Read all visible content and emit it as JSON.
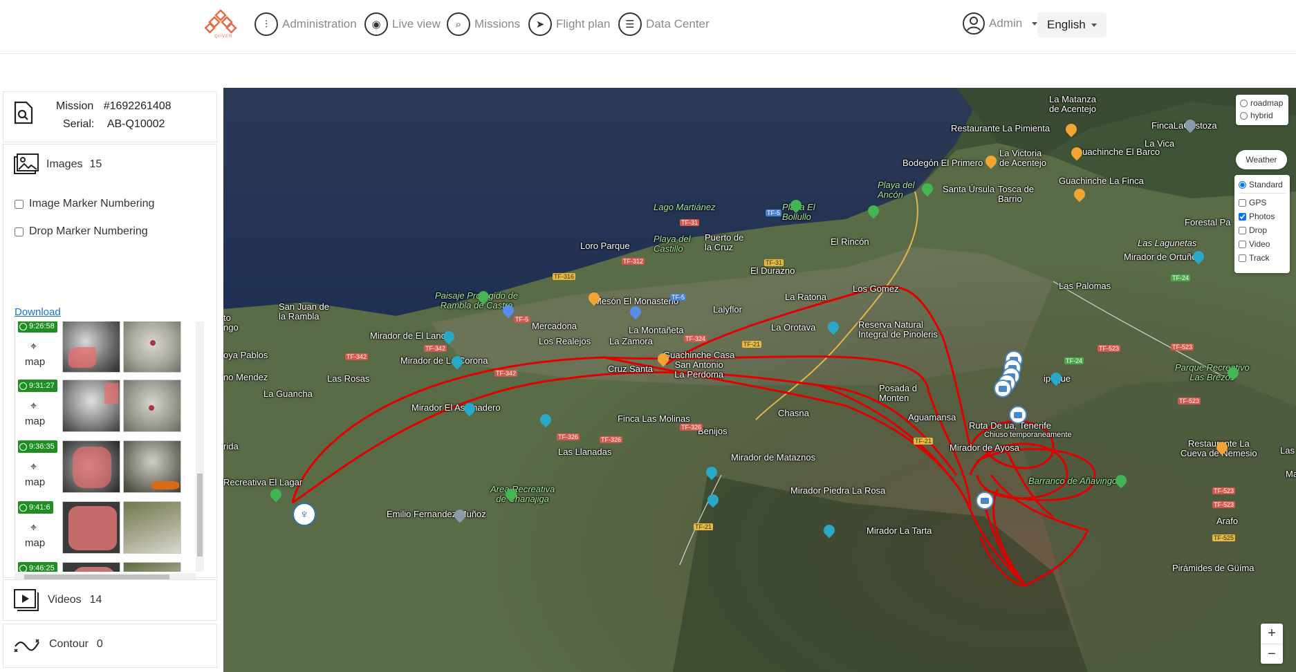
{
  "nav": {
    "logo_text": "QIIVER",
    "items": [
      {
        "label": "Administration",
        "icon": "sliders-icon"
      },
      {
        "label": "Live view",
        "icon": "broadcast-icon"
      },
      {
        "label": "Missions",
        "icon": "mission-search-icon"
      },
      {
        "label": "Flight plan",
        "icon": "paper-plane-icon"
      },
      {
        "label": "Data Center",
        "icon": "server-icon"
      }
    ],
    "user": "Admin",
    "language": "English"
  },
  "mission": {
    "mission_label": "Mission",
    "mission_value": "#1692261408",
    "serial_label": "Serial:",
    "serial_value": "AB-Q10002"
  },
  "images": {
    "title": "Images",
    "count": "15",
    "image_marker_numbering": "Image Marker Numbering",
    "drop_marker_numbering": "Drop Marker Numbering",
    "download": "Download",
    "rows": [
      {
        "time": "9:26:58",
        "map": "map"
      },
      {
        "time": "9:31:27",
        "map": "map"
      },
      {
        "time": "9:36:35",
        "map": "map"
      },
      {
        "time": "9:41:6",
        "map": "map"
      },
      {
        "time": "9:46:25",
        "map": "map"
      }
    ]
  },
  "videos": {
    "title": "Videos",
    "count": "14"
  },
  "contour": {
    "title": "Contour",
    "count": "0"
  },
  "map": {
    "map_types": [
      "roadmap",
      "hybrid"
    ],
    "weather": "Weather",
    "layers": [
      {
        "label": "Standard",
        "kind": "radio",
        "checked": true
      },
      {
        "label": "GPS",
        "kind": "checkbox",
        "checked": false
      },
      {
        "label": "Photos",
        "kind": "checkbox",
        "checked": true
      },
      {
        "label": "Drop",
        "kind": "checkbox",
        "checked": false
      },
      {
        "label": "Video",
        "kind": "checkbox",
        "checked": false
      },
      {
        "label": "Track",
        "kind": "checkbox",
        "checked": false
      }
    ],
    "zoom_in": "+",
    "zoom_out": "−",
    "track_color": "#e00000",
    "places": {
      "la_matanza": "La Matanza\nde Acentejo",
      "fincalagustoza": "FincaLaGustoza",
      "restaurante_pimienta": "Restaurante La Pimienta",
      "la_vica": "La Vica",
      "la_victoria": "La Victoria\nde Acentejo",
      "guachinche_barco": "Guachinche El Barco",
      "bodegon": "Bodegón El Primero",
      "playa_ancon": "Playa del\nAncón",
      "santa_ursula": "Santa Úrsula",
      "tosca": "Tosca de\nBarrio",
      "guachinche_finca": "Guachinche La Finca",
      "forestal": "Forestal Pa",
      "lago": "Lago Martiánez",
      "playa_bollullo": "Playa El\nBollullo",
      "las_lagunetas": "Las Lagunetas",
      "mirador_ortuno": "Mirador de Ortuño",
      "loro_parque": "Loro Parque",
      "playa_castillo": "Playa del\nCastillo",
      "puerto": "Puerto de\nla Cruz",
      "el_rincon": "El Rincón",
      "el_durazno": "El Durazno",
      "las_palomas": "Las Palomas",
      "los_gomez": "Los Gomez",
      "paisaje": "Paisaje Protegido de\nRambla de Castro",
      "meson": "Mesón El Monasterio",
      "la_ratona": "La Ratona",
      "san_juan": "San Juan de\nla Rambla",
      "lalyflor": "Lalyflor",
      "mirador_lance": "Mirador de El Lance",
      "mercadona": "Mercadona",
      "la_montaneta": "La Montañeta",
      "la_orotava": "La Orotava",
      "reserva": "Reserva Natural\nIntegral de Pinoleris",
      "to_ongo": "to\nngo",
      "los_realejos": "Los Realejos",
      "la_zamora": "La Zamora",
      "oya_pablos": "oya Pablos",
      "mirador_corona": "Mirador de La Corona",
      "guachinche_casa": "Guachinche Casa\nSan Antonio\nLa Perdoma",
      "parque_recreativo": "Parque Recreativo\nLas Brezos",
      "no_mendez": "no Mendez",
      "las_rosas": "Las Rosas",
      "la_guancha": "La Guancha",
      "cruz_santa": "Cruz Santa",
      "posada": "Posada d\nMonten",
      "ipeque": "ipeque",
      "mirador_asomadero": "Mirador El Asomadero",
      "chasna": "Chasna",
      "finca_molinas": "Finca Las Molinas",
      "aguamansa": "Aguamansa",
      "benijos": "Benijos",
      "ruta": "Ruta De    ua, Tenerife",
      "chiuso": "Chiuso temporaneamente",
      "rida": "rida",
      "las_llanadas": "Las Llanadas",
      "mirador_ayosa": "Mirador de Ayosa",
      "restaurante_nemesio": "Restaurante La\nCueva de Nemesio",
      "las_edge": "Las",
      "mirador_mataznos": "Mirador de Mataznos",
      "ma_edge": "Ma",
      "recreativa_lagar": "Recreativa El Lagar",
      "barranco": "Barranco de Añavingo",
      "area_chanajiga": "Area Recreativa\nde Chanajiga",
      "mirador_piedra": "Mirador Piedra La Rosa",
      "emilio": "Emilio Fernandez Muñoz",
      "arafo": "Arafo",
      "mirador_tarta": "Mirador La Tarta",
      "piramides": "Pirámides de Güíma"
    }
  }
}
